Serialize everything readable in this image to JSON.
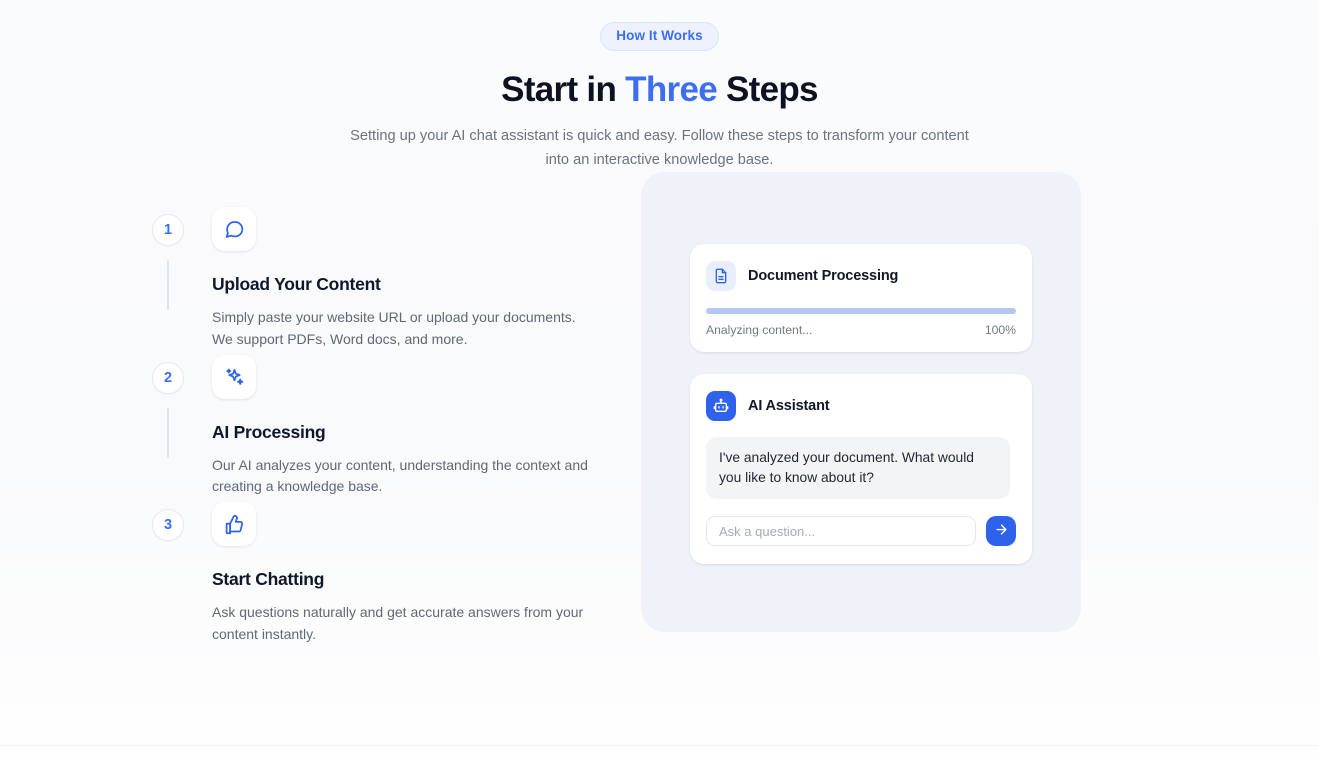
{
  "header": {
    "badge": "How It Works",
    "title_part1": "Start in ",
    "title_accent": "Three",
    "title_part2": " Steps",
    "subtitle": "Setting up your AI chat assistant is quick and easy. Follow these steps to transform your content into an interactive knowledge base."
  },
  "steps": [
    {
      "number": "1",
      "icon": "message-circle-icon",
      "title": "Upload Your Content",
      "description": "Simply paste your website URL or upload your documents. We support PDFs, Word docs, and more."
    },
    {
      "number": "2",
      "icon": "sparkles-icon",
      "title": "AI Processing",
      "description": "Our AI analyzes your content, understanding the context and creating a knowledge base."
    },
    {
      "number": "3",
      "icon": "thumbs-up-icon",
      "title": "Start Chatting",
      "description": "Ask questions naturally and get accurate answers from your content instantly."
    }
  ],
  "demo": {
    "document_card": {
      "icon": "file-text-icon",
      "title": "Document Processing",
      "status": "Analyzing content...",
      "percent": "100%",
      "progress_value": 100
    },
    "assistant_card": {
      "avatar_icon": "bot-icon",
      "title": "AI Assistant",
      "message": "I've analyzed your document. What would you like to know about it?",
      "input_placeholder": "Ask a question...",
      "input_value": "",
      "send_icon": "arrow-right-icon"
    }
  },
  "colors": {
    "accent": "#3b6ef0",
    "accent_solid": "#2f62eb",
    "badge_bg": "#eef2ff",
    "badge_border": "#dbe4fb",
    "panel_bg": "#eff2f9",
    "progress_fill": "#b4c7f0",
    "bubble_bg": "#f3f4f6",
    "heading": "#0d1220",
    "muted_text": "#6b7280"
  }
}
